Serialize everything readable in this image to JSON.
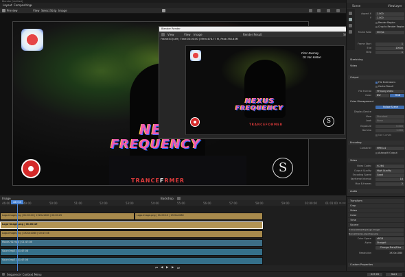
{
  "window": {
    "title": "Blender [Untitled]"
  },
  "menubar": {
    "items": [
      "Layout",
      "Compositing",
      "+"
    ]
  },
  "viewport_header": {
    "mode": "Preview",
    "menus": [
      "View",
      "Select",
      "Strip",
      "Image"
    ]
  },
  "preview": {
    "big_word_1": "NEX",
    "big_word_2": "FREQUENCY",
    "brand_word_1": "TRANCE",
    "brand_word_2": "F",
    "brand_word_3": "RMER",
    "seal_letter": "S"
  },
  "render_window": {
    "title": "Blender Render",
    "menus": [
      "View",
      "View",
      "Image"
    ],
    "slot": "Render Result",
    "slot_number": "Slot 1",
    "info": "Frame:87|449 | Time:00:00:00 | Mem:478.77 M, Peak:780.63M",
    "img_text_1": "First Journey",
    "img_text_2": "DJ Van Ketten",
    "img_big_1": "NEXUS",
    "img_big_2": "FREQUENCY",
    "img_brand": "TRANCEFORMER"
  },
  "properties": {
    "scene_tab": "Scene",
    "scene_name": "ViewLayer",
    "rows_top": [
      {
        "key": "Aspect X",
        "value": "1.000"
      },
      {
        "key": "Y",
        "value": "1.000"
      }
    ],
    "render_region": "Render Region",
    "crop": "Crop to Render Region",
    "frame_rate_label": "Frame Rate",
    "frame_rate": "30 fps",
    "frame_start_label": "Frame Start",
    "frame_start": "1",
    "frame_end_label": "End",
    "frame_end": "10000",
    "step_label": "Step",
    "step": "1",
    "stretching_label": "Stretching",
    "video_label": "Video",
    "output_section": "Output",
    "file_format_label": "File Format",
    "file_format": "FFmpeg Video",
    "color_label": "Color",
    "color_modes": [
      "BW",
      "RGB"
    ],
    "color_mgmt_label": "Color Management",
    "follow_scene": "Follow Scene",
    "display_device_label": "Display Device",
    "view_label": "View",
    "view_value": "Standard",
    "look_label": "Look",
    "look_value": "None",
    "exposure_label": "Exposure",
    "exposure": "0.000",
    "gamma_label": "Gamma",
    "gamma": "1.000",
    "use_curves": "Use Curves",
    "encoding_section": "Encoding",
    "container_label": "Container",
    "container": "MPEG-4",
    "autosplit": "Autosplit Output",
    "video_section": "Video",
    "video_codec_label": "Video Codec",
    "video_codec": "H.264",
    "output_quality_label": "Output Quality",
    "output_quality": "High Quality",
    "encoding_speed_label": "Encoding Speed",
    "encoding_speed": "Good",
    "keyframe_label": "Keyframe Interval",
    "keyframe": "18",
    "max_b_label": "Max B-frames",
    "max_b": "2",
    "audio_section": "Audio",
    "strip_sections": [
      "Transform",
      "Crop",
      "Video",
      "Color",
      "Time",
      "Source"
    ],
    "source_path": "C:\\Users\\Desktop\\Logo-Image\\",
    "source_file": "NexusOneday-Logo/logo.png",
    "color_space_label": "Color Space",
    "color_space": "sRGB",
    "alpha_label": "Alpha",
    "alpha": "Straight",
    "change_data": "Change Data/Files",
    "resolution_label": "Resolution",
    "resolution": "1920x1080",
    "custom_props": "Custom Properties",
    "bottom_value": "247.03",
    "bottom_btn": "Start"
  },
  "sequencer": {
    "header_left": "Image",
    "header_mid": "Backdrop",
    "ruler": [
      "46:00",
      "49:00",
      "50:00",
      "51:00",
      "52:00",
      "53:00",
      "54:00",
      "55:00",
      "56:00",
      "57:00",
      "58:00",
      "59:00",
      "01:00:00",
      "01:01:00",
      "01:02:00"
    ],
    "playhead": "46+55",
    "strips": [
      "Logo-Image.png | 0h:00:10 | 1920x1080 | 00:00:25",
      "Logo-Image.png | 0h:00:10 | 1920x1080",
      "Logo-Image.png | 0h:00:19",
      "Logo-Image.png | 1920x1080 | 00:47:46",
      "Movie-HD.mp4 | 01:47:08",
      "Sound.mp3 | 01:47:08",
      "Sound.mp3 | 01:47:08"
    ]
  },
  "statusbar": {
    "left": "Sequencer Context Menu",
    "right": "2.93.4"
  }
}
